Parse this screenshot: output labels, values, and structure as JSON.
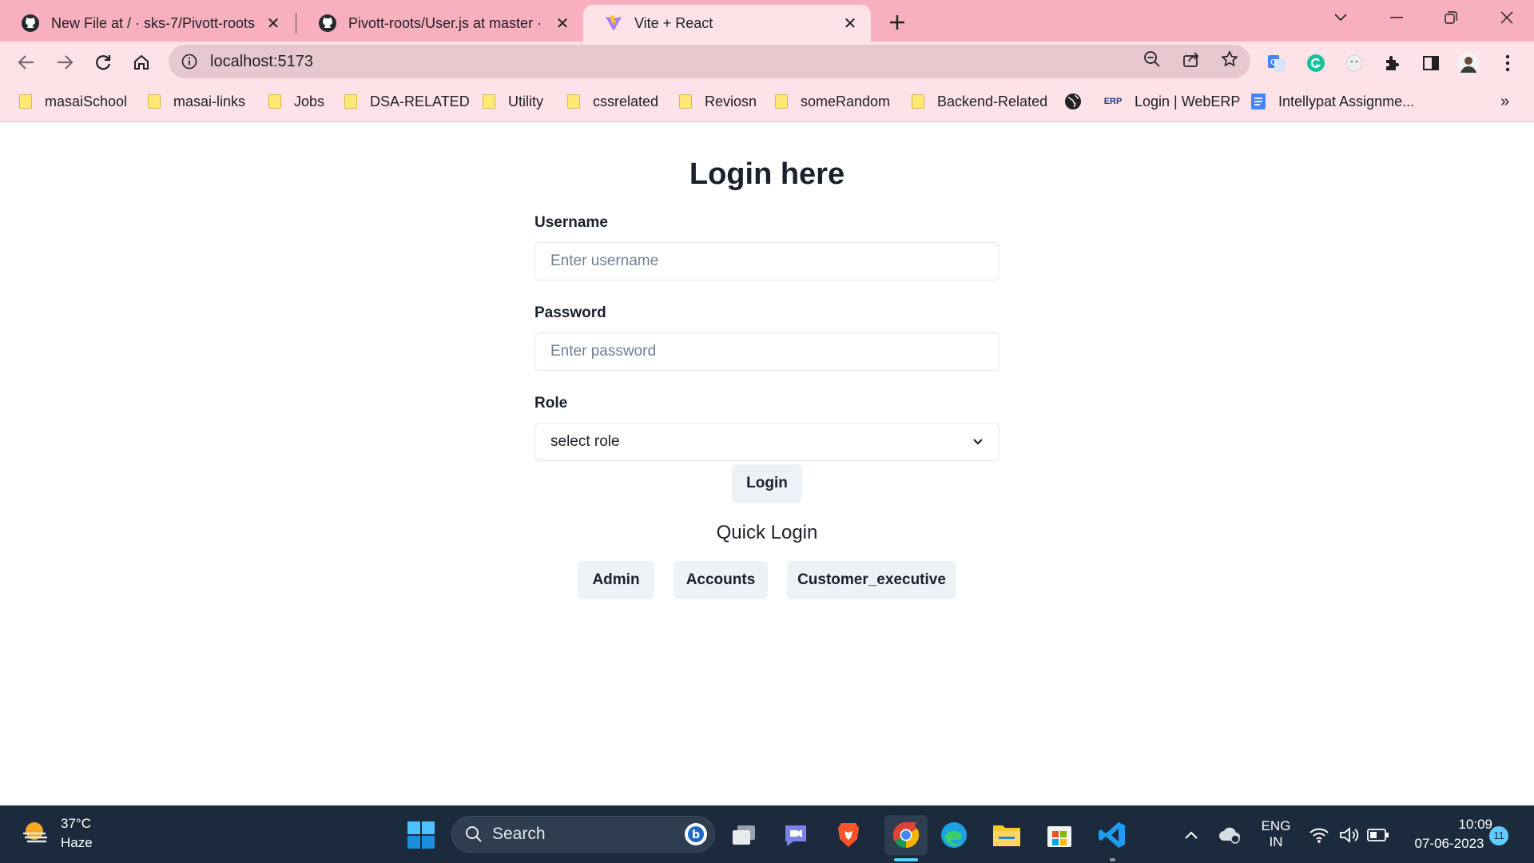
{
  "browser": {
    "tabs": [
      {
        "title": "New File at / · sks-7/Pivott-roots",
        "icon": "github-icon"
      },
      {
        "title": "Pivott-roots/User.js at master · sk",
        "icon": "github-icon"
      },
      {
        "title": "Vite + React",
        "icon": "vite-icon",
        "active": true
      }
    ],
    "url": "localhost:5173",
    "bookmarks": [
      {
        "label": "masaiSchool",
        "icon": "folder-icon"
      },
      {
        "label": "masai-links",
        "icon": "folder-icon"
      },
      {
        "label": "Jobs",
        "icon": "folder-icon"
      },
      {
        "label": "DSA-RELATED",
        "icon": "folder-icon"
      },
      {
        "label": "Utility",
        "icon": "folder-icon"
      },
      {
        "label": "cssrelated",
        "icon": "folder-icon"
      },
      {
        "label": "Reviosn",
        "icon": "folder-icon"
      },
      {
        "label": "someRandom",
        "icon": "folder-icon"
      },
      {
        "label": "Backend-Related",
        "icon": "folder-icon"
      },
      {
        "label": "",
        "icon": "globe-icon"
      },
      {
        "label": "Login | WebERP",
        "icon": "erp-icon",
        "icon_text": "ERP"
      },
      {
        "label": "Intellypat Assignme...",
        "icon": "docs-icon"
      }
    ],
    "overflow": "»",
    "colors": {
      "tabbar": "#f9b0be",
      "toolbar": "#fde2e7",
      "omnibox": "#e8c8cf"
    }
  },
  "login": {
    "title": "Login here",
    "username_label": "Username",
    "username_placeholder": "Enter username",
    "password_label": "Password",
    "password_placeholder": "Enter password",
    "role_label": "Role",
    "role_selected": "select role",
    "login_button": "Login",
    "quick_login_title": "Quick Login",
    "quick_buttons": [
      "Admin",
      "Accounts",
      "Customer_executive"
    ]
  },
  "taskbar": {
    "temperature": "37°C",
    "condition": "Haze",
    "search_label": "Search",
    "lang": "ENG",
    "region": "IN",
    "time": "10:09",
    "date": "07-06-2023",
    "notifications": "11",
    "colors": {
      "background": "#1b2a3d"
    }
  }
}
